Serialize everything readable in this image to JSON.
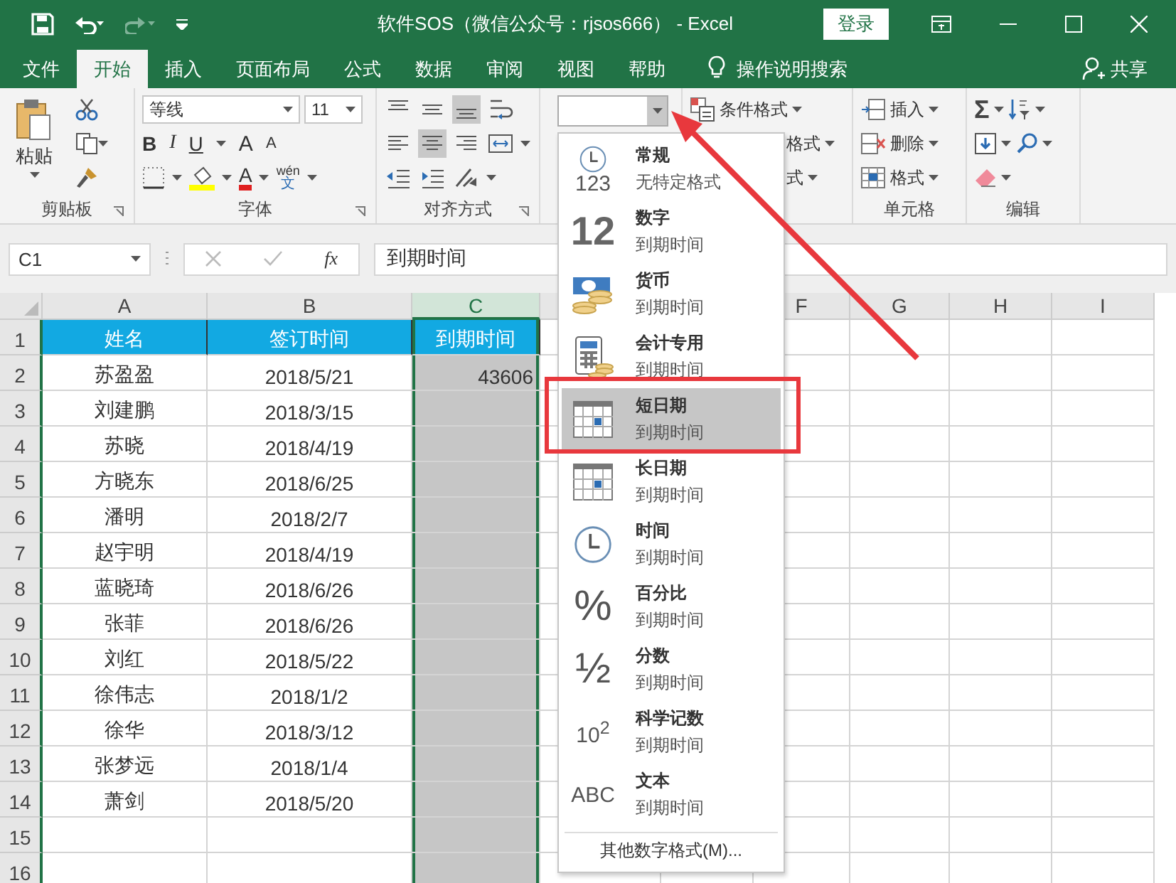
{
  "title_bar": {
    "title": "软件SOS（微信公众号：rjsos666） - Excel",
    "login": "登录"
  },
  "tabs": [
    {
      "label": "文件",
      "selected": false
    },
    {
      "label": "开始",
      "selected": true
    },
    {
      "label": "插入",
      "selected": false
    },
    {
      "label": "页面布局",
      "selected": false
    },
    {
      "label": "公式",
      "selected": false
    },
    {
      "label": "数据",
      "selected": false
    },
    {
      "label": "审阅",
      "selected": false
    },
    {
      "label": "视图",
      "selected": false
    },
    {
      "label": "帮助",
      "selected": false
    }
  ],
  "tell_me": "操作说明搜索",
  "share": "共享",
  "ribbon": {
    "clipboard": {
      "paste": "粘贴",
      "label": "剪贴板"
    },
    "font": {
      "name": "等线",
      "size": "11",
      "bold": "B",
      "italic": "I",
      "underline": "U",
      "grow": "A",
      "shrink": "A",
      "color_letter": "A",
      "phonetic_top": "wén",
      "phonetic_bottom": "文",
      "label": "字体"
    },
    "alignment": {
      "label": "对齐方式"
    },
    "styles": {
      "items": [
        "条件格式",
        "格式",
        "式"
      ]
    },
    "cells": {
      "items": [
        "插入",
        "删除",
        "格式"
      ],
      "label": "单元格"
    },
    "editing": {
      "sum": "Σ",
      "label": "编辑"
    }
  },
  "formula_bar": {
    "name_box": "C1",
    "function": "fx",
    "formula": "到期时间"
  },
  "sheet": {
    "columns": [
      {
        "label": "A",
        "selected": false
      },
      {
        "label": "B",
        "selected": false
      },
      {
        "label": "C",
        "selected": true
      },
      {
        "label": "F",
        "selected": false
      },
      {
        "label": "G",
        "selected": false
      },
      {
        "label": "H",
        "selected": false
      },
      {
        "label": "I",
        "selected": false
      }
    ],
    "rows": [
      {
        "number": "1",
        "kind": "header",
        "cells": [
          "姓名",
          "签订时间",
          "到期时间"
        ]
      },
      {
        "number": "2",
        "kind": "data",
        "cells": [
          "苏盈盈",
          "2018/5/21",
          "43606"
        ]
      },
      {
        "number": "3",
        "kind": "data",
        "cells": [
          "刘建鹏",
          "2018/3/15"
        ]
      },
      {
        "number": "4",
        "kind": "data",
        "cells": [
          "苏晓",
          "2018/4/19"
        ]
      },
      {
        "number": "5",
        "kind": "data",
        "cells": [
          "方晓东",
          "2018/6/25"
        ]
      },
      {
        "number": "6",
        "kind": "data",
        "cells": [
          "潘明",
          "2018/2/7"
        ]
      },
      {
        "number": "7",
        "kind": "data",
        "cells": [
          "赵宇明",
          "2018/4/19"
        ]
      },
      {
        "number": "8",
        "kind": "data",
        "cells": [
          "蓝晓琦",
          "2018/6/26"
        ]
      },
      {
        "number": "9",
        "kind": "data",
        "cells": [
          "张菲",
          "2018/6/26"
        ]
      },
      {
        "number": "10",
        "kind": "data",
        "cells": [
          "刘红",
          "2018/5/22"
        ]
      },
      {
        "number": "11",
        "kind": "data",
        "cells": [
          "徐伟志",
          "2018/1/2"
        ]
      },
      {
        "number": "12",
        "kind": "data",
        "cells": [
          "徐华",
          "2018/3/12"
        ]
      },
      {
        "number": "13",
        "kind": "data",
        "cells": [
          "张梦远",
          "2018/1/4"
        ]
      },
      {
        "number": "14",
        "kind": "data",
        "cells": [
          "萧剑",
          "2018/5/20"
        ]
      },
      {
        "number": "15",
        "kind": "data"
      },
      {
        "number": "16",
        "kind": "data"
      }
    ]
  },
  "number_menu": {
    "items": [
      {
        "kind": "general",
        "glyph": "123",
        "name": "常规",
        "sample": "无特定格式",
        "selected": false
      },
      {
        "kind": "number",
        "glyph": "12",
        "name": "数字",
        "sample": "到期时间",
        "selected": false
      },
      {
        "kind": "currency",
        "name": "货币",
        "sample": "到期时间",
        "selected": false
      },
      {
        "kind": "accounting",
        "name": "会计专用",
        "sample": "到期时间",
        "selected": false
      },
      {
        "kind": "short_date",
        "name": "短日期",
        "sample": "到期时间",
        "selected": true
      },
      {
        "kind": "long_date",
        "name": "长日期",
        "sample": "到期时间",
        "selected": false
      },
      {
        "kind": "time",
        "name": "时间",
        "sample": "到期时间",
        "selected": false
      },
      {
        "kind": "percent",
        "glyph": "%",
        "name": "百分比",
        "sample": "到期时间",
        "selected": false
      },
      {
        "kind": "fraction",
        "glyph": "½",
        "name": "分数",
        "sample": "到期时间",
        "selected": false
      },
      {
        "kind": "scientific",
        "glyph": "10$^{2}$",
        "name": "科学记数",
        "sample": "到期时间",
        "selected": false
      },
      {
        "kind": "text",
        "glyph": "ABC",
        "name": "文本",
        "sample": "到期时间",
        "selected": false
      }
    ],
    "more": "其他数字格式(M)..."
  }
}
